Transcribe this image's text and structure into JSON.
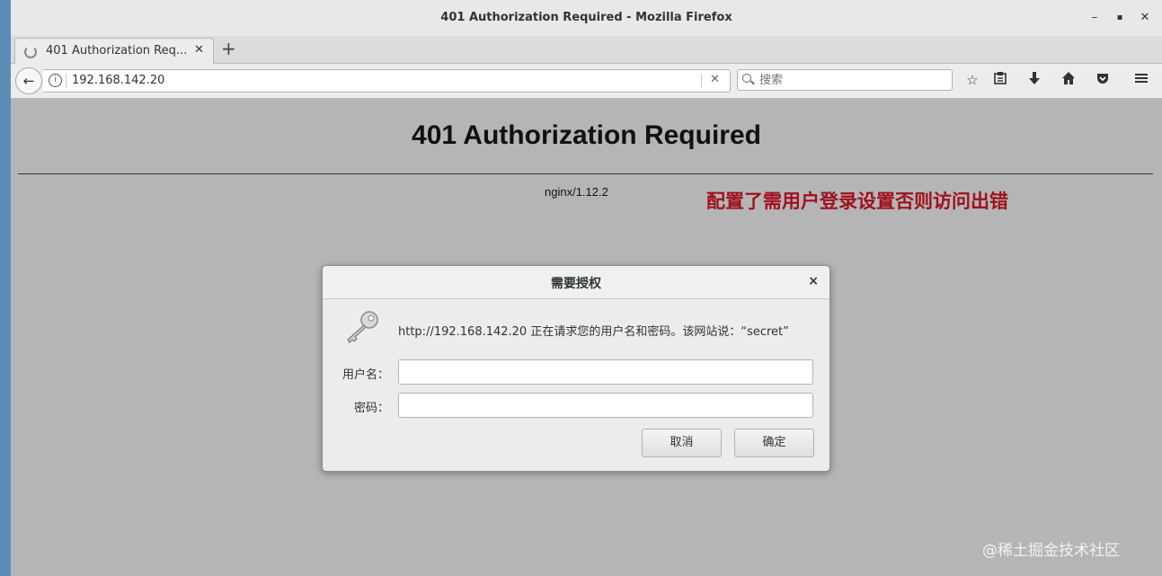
{
  "window": {
    "title": "401 Authorization Required - Mozilla Firefox",
    "controls": {
      "minimize": "–",
      "maximize": "▪",
      "close": "✕"
    }
  },
  "tabs": [
    {
      "label": "401 Authorization Req...",
      "close": "✕"
    }
  ],
  "new_tab": "+",
  "navbar": {
    "url": "192.168.142.20",
    "url_clear": "✕",
    "search_placeholder": "搜索",
    "icons": [
      "star-icon",
      "reading-list-icon",
      "download-icon",
      "home-icon",
      "pocket-icon",
      "menu-icon"
    ]
  },
  "page": {
    "heading": "401 Authorization Required",
    "server": "nginx/1.12.2",
    "annotation": "配置了需用户登录设置否则访问出错",
    "annotation_color": "#a0101e"
  },
  "dialog": {
    "title": "需要授权",
    "close": "×",
    "message": "http://192.168.142.20 正在请求您的用户名和密码。该网站说：“secret”",
    "username_label": "用户名：",
    "username_value": "",
    "password_label": "密码：",
    "password_value": "",
    "cancel_label": "取消",
    "ok_label": "确定"
  },
  "watermark": "@稀土掘金技术社区"
}
